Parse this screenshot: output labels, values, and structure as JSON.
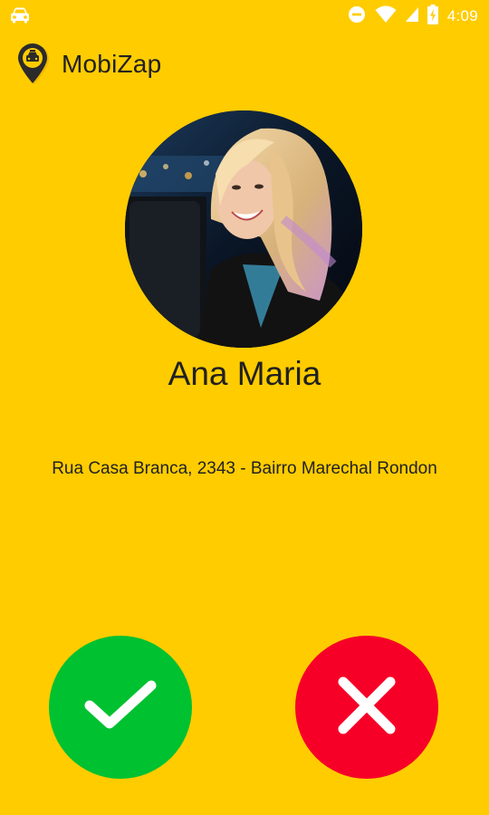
{
  "status_bar": {
    "time": "4:09",
    "icons": [
      "car-icon",
      "do-not-disturb-icon",
      "wifi-icon",
      "signal-icon",
      "battery-charging-icon"
    ],
    "icon_color": "#FFFFFF"
  },
  "app_bar": {
    "title": "MobiZap",
    "logo_icon": "taxi-pin-icon"
  },
  "passenger": {
    "name": "Ana Maria",
    "address": "Rua Casa Branca, 2343 - Bairro Marechal Rondon",
    "photo": "passenger-photo"
  },
  "actions": {
    "accept_icon": "check-icon",
    "reject_icon": "close-icon"
  },
  "colors": {
    "background": "#FFCC00",
    "accept": "#00C130",
    "reject": "#F70028",
    "text": "#212121"
  }
}
